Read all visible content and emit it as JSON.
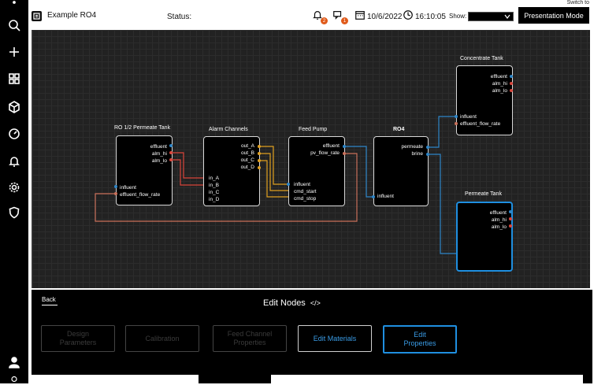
{
  "header": {
    "switch_to": "Switch to",
    "app_title": "Example RO4",
    "status_label": "Status:",
    "alert_count": "2",
    "message_count": "1",
    "date": "10/6/2022",
    "time": "16:10:05",
    "show_label": "Show:",
    "show_value": "",
    "presentation_button": "Presentation Mode"
  },
  "sidebar": {
    "icons": [
      "search-icon",
      "add-icon",
      "dashboard-icon",
      "cube-icon",
      "gauge-icon",
      "bell-icon",
      "gear-icon",
      "shield-icon",
      "user-icon",
      "key-icon"
    ]
  },
  "nodes": {
    "permeate_tank_12": {
      "title": "RO 1/2 Permeate Tank",
      "outputs": [
        "effluent",
        "alm_hi",
        "alm_lo"
      ],
      "inputs": [
        "influent",
        "effluent_flow_rate"
      ]
    },
    "alarm_channels": {
      "title": "Alarm Channels",
      "outputs": [
        "out_A",
        "out_B",
        "out_C",
        "out_D"
      ],
      "inputs": [
        "in_A",
        "in_B",
        "in_C",
        "in_D"
      ]
    },
    "feed_pump": {
      "title": "Feed Pump",
      "outputs": [
        "effluent",
        "pv_flow_rate"
      ],
      "inputs": [
        "influent",
        "cmd_start",
        "cmd_stop"
      ]
    },
    "ro4": {
      "title": "RO4",
      "outputs": [
        "permeate",
        "brine"
      ],
      "inputs": [
        "influent"
      ]
    },
    "concentrate_tank": {
      "title": "Concentrate Tank",
      "outputs": [
        "effluent",
        "alm_hi",
        "alm_lo"
      ],
      "inputs": [
        "influent",
        "effluent_flow_rate"
      ]
    },
    "permeate_tank": {
      "title": "Permeate Tank",
      "outputs": [
        "effluent",
        "alm_hi",
        "alm_lo"
      ],
      "inputs": []
    }
  },
  "panel": {
    "back_label": "Back",
    "title": "Edit Nodes",
    "title_icon": "</>",
    "buttons": {
      "design": "Design\nParameters",
      "calibration": "Calibration",
      "feed_channel": "Feed Channel\nProperties",
      "edit_materials": "Edit Materials",
      "edit_properties": "Edit\nProperties"
    }
  },
  "colors": {
    "accent_blue": "#1f8fe0",
    "wire_blue": "#2e86c8",
    "wire_red": "#d9443a",
    "wire_orange": "#e0a020",
    "wire_tan": "#c9705a"
  }
}
